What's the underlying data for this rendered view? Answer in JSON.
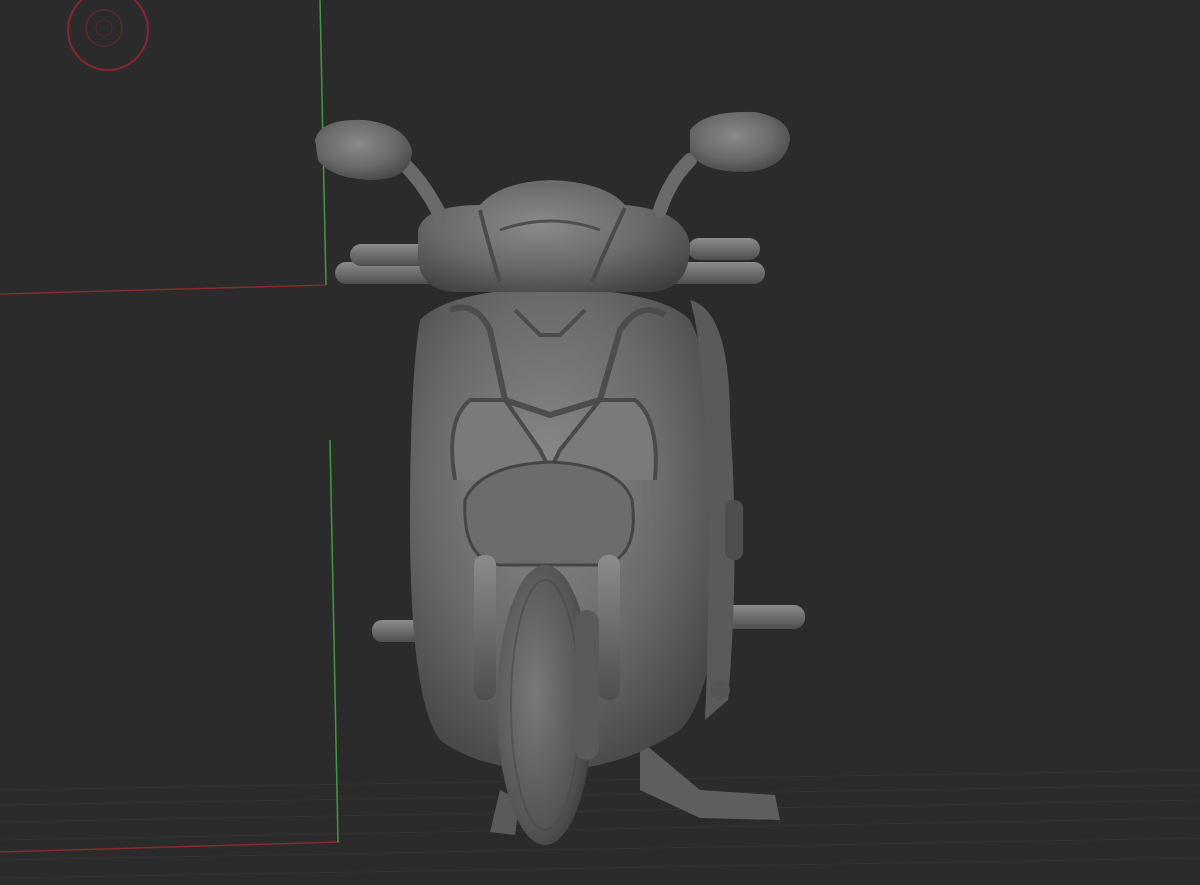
{
  "viewport": {
    "background_color": "#2b2b2b",
    "floor_line_color": "#333333",
    "model_color": "#6e6e6e",
    "model_shadow_color": "#3c3c3c",
    "model_highlight_color": "#8e8e8e"
  },
  "axes": {
    "x_axis_color": "#8a2b2b",
    "y_axis_color": "#3f9a3f"
  },
  "gizmo": {
    "icon": "rotation-gizmo-icon",
    "color": "#8a2530"
  },
  "model": {
    "icon": "scooter-3d-model"
  }
}
